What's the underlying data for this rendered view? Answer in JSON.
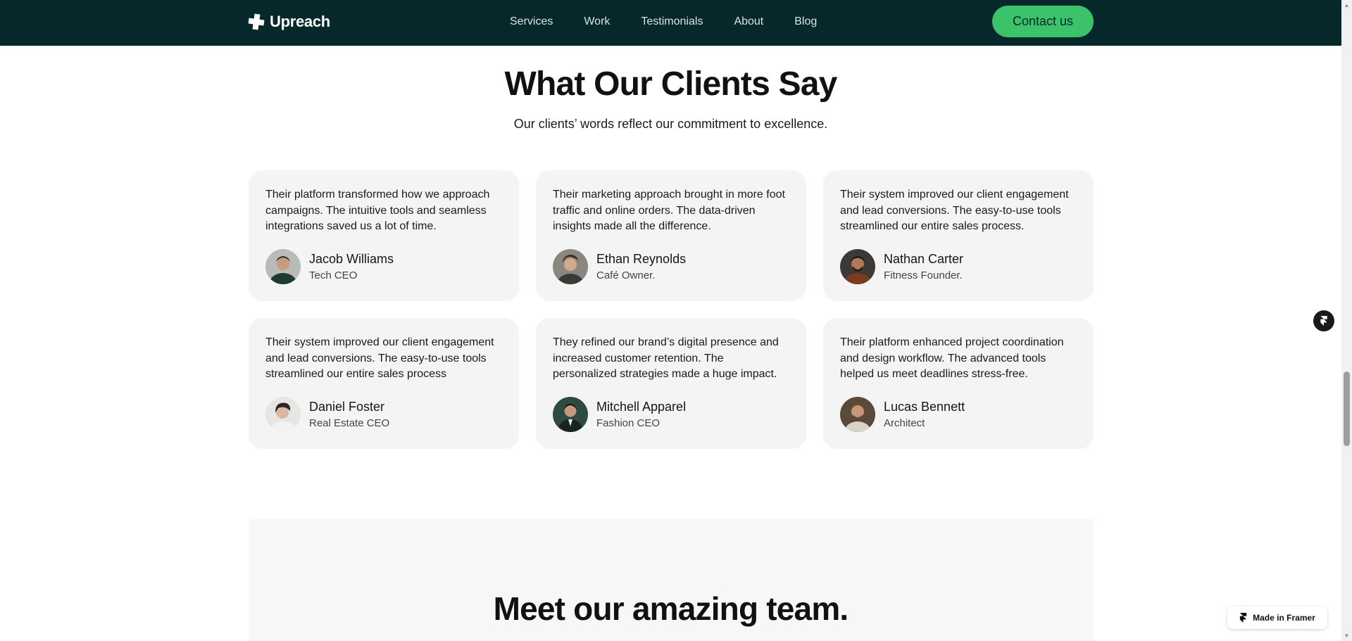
{
  "nav": {
    "logo_text": "Upreach",
    "links": [
      "Services",
      "Work",
      "Testimonials",
      "About",
      "Blog"
    ],
    "contact_label": "Contact us"
  },
  "testimonials": {
    "title": "What Our Clients Say",
    "subtitle": "Our clients’ words reflect our commitment to excellence.",
    "cards": [
      {
        "quote": "Their platform transformed how we approach campaigns. The intuitive tools and seamless integrations saved us a lot of time.",
        "name": "Jacob Williams",
        "role": "Tech CEO"
      },
      {
        "quote": "Their marketing approach brought in more foot traffic and online orders. The data-driven insights made all the difference.",
        "name": "Ethan Reynolds",
        "role": "Café Owner."
      },
      {
        "quote": "Their system improved our client engagement and lead conversions. The easy-to-use tools streamlined our entire sales process.",
        "name": "Nathan Carter",
        "role": "Fitness Founder."
      },
      {
        "quote": "Their system improved our client engagement and lead conversions. The easy-to-use tools streamlined our entire sales process",
        "name": "Daniel Foster",
        "role": "Real Estate CEO"
      },
      {
        "quote": "They refined our brand’s digital presence and increased customer retention. The personalized strategies made a huge impact.",
        "name": "Mitchell Apparel",
        "role": "Fashion CEO"
      },
      {
        "quote": "Their platform enhanced project coordination and design workflow. The advanced tools helped us meet deadlines stress-free.",
        "name": "Lucas Bennett",
        "role": "Architect"
      }
    ]
  },
  "team": {
    "title": "Meet our amazing team."
  },
  "badge": {
    "label": "Made in Framer"
  },
  "colors": {
    "nav_bg": "#06282a",
    "accent": "#3cc26a",
    "card_bg": "#f4f4f4"
  },
  "icons": {
    "logo": "plus-logo-icon",
    "framer": "framer-icon"
  }
}
